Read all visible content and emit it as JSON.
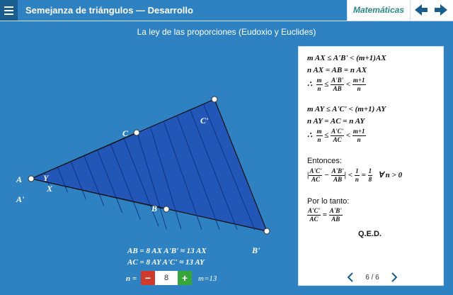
{
  "header": {
    "title": "Semejanza de triángulos  —  Desarrollo",
    "subject": "Matemáticas"
  },
  "main": {
    "heading": "La ley de las proporciones (Eudoxio y Euclides)"
  },
  "figure": {
    "labels": {
      "A": "A",
      "Aprime": "A'",
      "B": "B",
      "Bprime": "B'",
      "C": "C",
      "Cprime": "C'",
      "X": "X",
      "Y": "Y"
    }
  },
  "panel": {
    "line1": "m AX ≤ A'B' < (m+1)AX",
    "line2": "n AX = AB = n AX",
    "therefore": "∴",
    "f1": {
      "m": "m",
      "n": "n",
      "a": "A'B'",
      "ab": "AB",
      "m1": "m+1",
      "n2": "n",
      "le": "≤",
      "lt": "<"
    },
    "line3": "m AY ≤ A'C' < (m+1) AY",
    "line4": "n AY = AC = n AY",
    "f2": {
      "m": "m",
      "n": "n",
      "a": "A'C'",
      "ac": "AC",
      "m1": "m+1",
      "n2": "n",
      "le": "≤",
      "lt": "<"
    },
    "entonces": "Entonces:",
    "f3": {
      "a": "A'C'",
      "ac": "AC",
      "b": "A'B'",
      "ab": "AB",
      "one": "1",
      "n": "n",
      "one2": "1",
      "eight": "8",
      "minus": "−",
      "lt": "<",
      "eq": "=",
      "forall": "∀ n > 0"
    },
    "porlotanto": "Por lo tanto:",
    "f4": {
      "a": "A'C'",
      "ac": "AC",
      "b": "A'B'",
      "ab": "AB",
      "eq": "="
    },
    "qed": "Q.E.D.",
    "pager": "6 / 6"
  },
  "bottom": {
    "eq1": "AB = 8 AX    A'B' ≈ 13 AX",
    "eq2": "AC = 8 AY    A'C' ≈ 13 AY",
    "n_label": "n =",
    "n_value": "8",
    "m_label": "m=13",
    "minus": "−",
    "plus": "+"
  },
  "colors": {
    "background": "#2f82c1",
    "triangle_fill": "#2257b8",
    "minus_button": "#cf3a2b",
    "plus_button": "#38a53a"
  }
}
